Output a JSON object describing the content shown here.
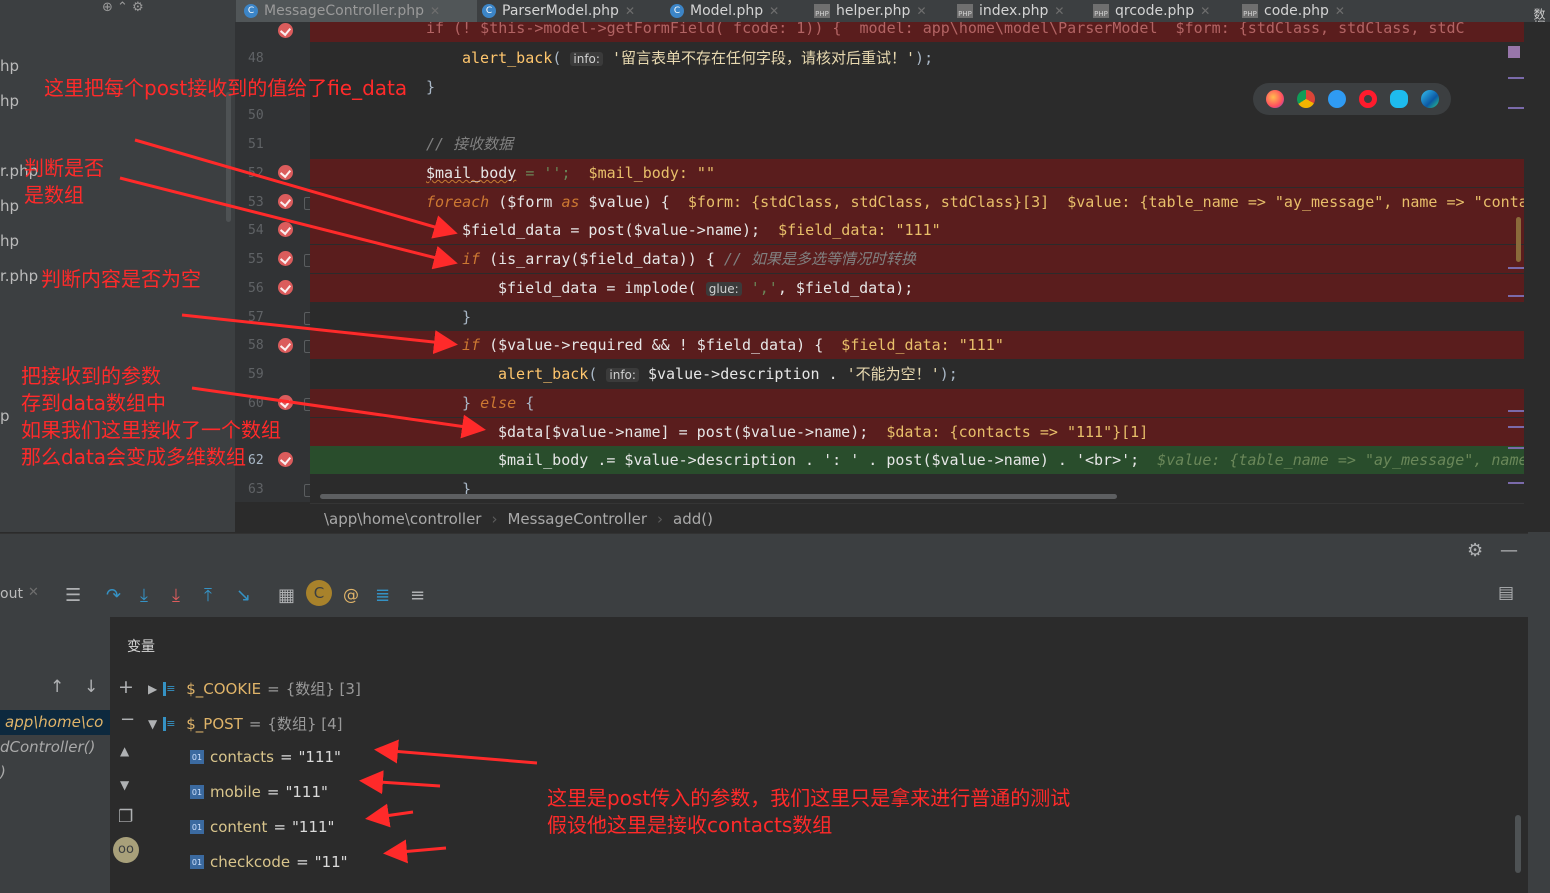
{
  "tabs": [
    {
      "label": "MessageController.php",
      "icon": "class-c-icon",
      "active": true
    },
    {
      "label": "ParserModel.php",
      "icon": "class-c-icon"
    },
    {
      "label": "Model.php",
      "icon": "class-c-icon"
    },
    {
      "label": "helper.php",
      "icon": "php-file-icon"
    },
    {
      "label": "index.php",
      "icon": "php-file-icon"
    },
    {
      "label": "qrcode.php",
      "icon": "php-file-icon"
    },
    {
      "label": "code.php",
      "icon": "php-file-icon"
    }
  ],
  "right_strip_label": "数据库",
  "project_items": [
    "hp",
    "hp",
    "r.php",
    "hp",
    "hp",
    "r.php",
    "p"
  ],
  "code": {
    "line_numbers": [
      "48",
      "50",
      "51",
      "52",
      "53",
      "54",
      "55",
      "56",
      "57",
      "58",
      "59",
      "60",
      "62",
      "63"
    ],
    "line47": "if (! $this->model->getFormField( fcode: 1)) {  model: app\\home\\model\\ParserModel  $form: {stdClass, stdClass, stdC",
    "line48_fn": "alert_back",
    "line48_hint": "info:",
    "line48_str": "'留言表单不存在任何字段，请核对后重试！'",
    "line48_end": ");",
    "line49": "}",
    "line51": "// 接收数据",
    "line52_var": "$mail_body",
    "line52_op": " = '';",
    "line52_inline": "  $mail_body: \"\"",
    "line53_kw": "foreach",
    "line53_a": " ($form ",
    "line53_as": "as",
    "line53_b": " $value) {",
    "line53_inline": "  $form: {stdClass, stdClass, stdClass}[3]  $value: {table_name => \"ay_message\", name => \"conta",
    "line54": "$field_data = post($value->name);",
    "line54_inline": "  $field_data: \"111\"",
    "line55_kw": "if",
    "line55_code": " (is_array($field_data)) { ",
    "line55_cmt": "// 如果是多选等情况时转换",
    "line56_a": "$field_data = implode( ",
    "line56_hint": "glue:",
    "line56_str": " ','",
    "line56_b": ", $field_data);",
    "line57": "}",
    "line58_kw": "if",
    "line58_code": " ($value->required && ! $field_data) {",
    "line58_inline": "  $field_data: \"111\"",
    "line59_fn": "alert_back",
    "line59_hint": "info:",
    "line59_code": " $value->description . ",
    "line59_str": "'不能为空！'",
    "line59_end": ");",
    "line60_a": "} ",
    "line60_kw": "else",
    "line60_b": " {",
    "line61": "$data[$value->name] = post($value->name);",
    "line61_inline": "  $data: {contacts => \"111\"}[1]",
    "line62": "$mail_body .= $value->description . ': ' . post($value->name) . '<br>';",
    "line62_inline": "  $value: {table_name => \"ay_message\", name",
    "line63": "}"
  },
  "breadcrumb": [
    "\\app\\home\\controller",
    "MessageController",
    "add()"
  ],
  "debugger": {
    "tab_label": "out",
    "variables_title": "变量",
    "frames": [
      "app\\home\\co",
      "dController()",
      ")"
    ],
    "variables": [
      {
        "name": "$_COOKIE",
        "value": "{数组} [3]",
        "expanded": false
      },
      {
        "name": "$_POST",
        "value": "{数组} [4]",
        "expanded": true
      }
    ],
    "post_items": [
      {
        "key": "contacts",
        "value": "\"111\""
      },
      {
        "key": "mobile",
        "value": "\"111\""
      },
      {
        "key": "content",
        "value": "\"111\""
      },
      {
        "key": "checkcode",
        "value": "\"11\""
      }
    ]
  },
  "annotations": {
    "a1": "这里把每个post接收到的值给了fie_data",
    "a2": "判断是否\n是数组",
    "a3": "判断内容是否为空",
    "a4": "把接收到的参数\n存到data数组中\n如果我们这里接收了一个数组\n那么data会变成多维数组",
    "a5": "这里是post传入的参数，我们这里只是拿来进行普通的测试\n假设他这里是接收contacts数组"
  },
  "colors": {
    "annotation": "#ff2a2a",
    "breakpoint_line": "#5a1d1d",
    "exec_line": "#294d2c",
    "editor_bg": "#2b2b2b"
  }
}
